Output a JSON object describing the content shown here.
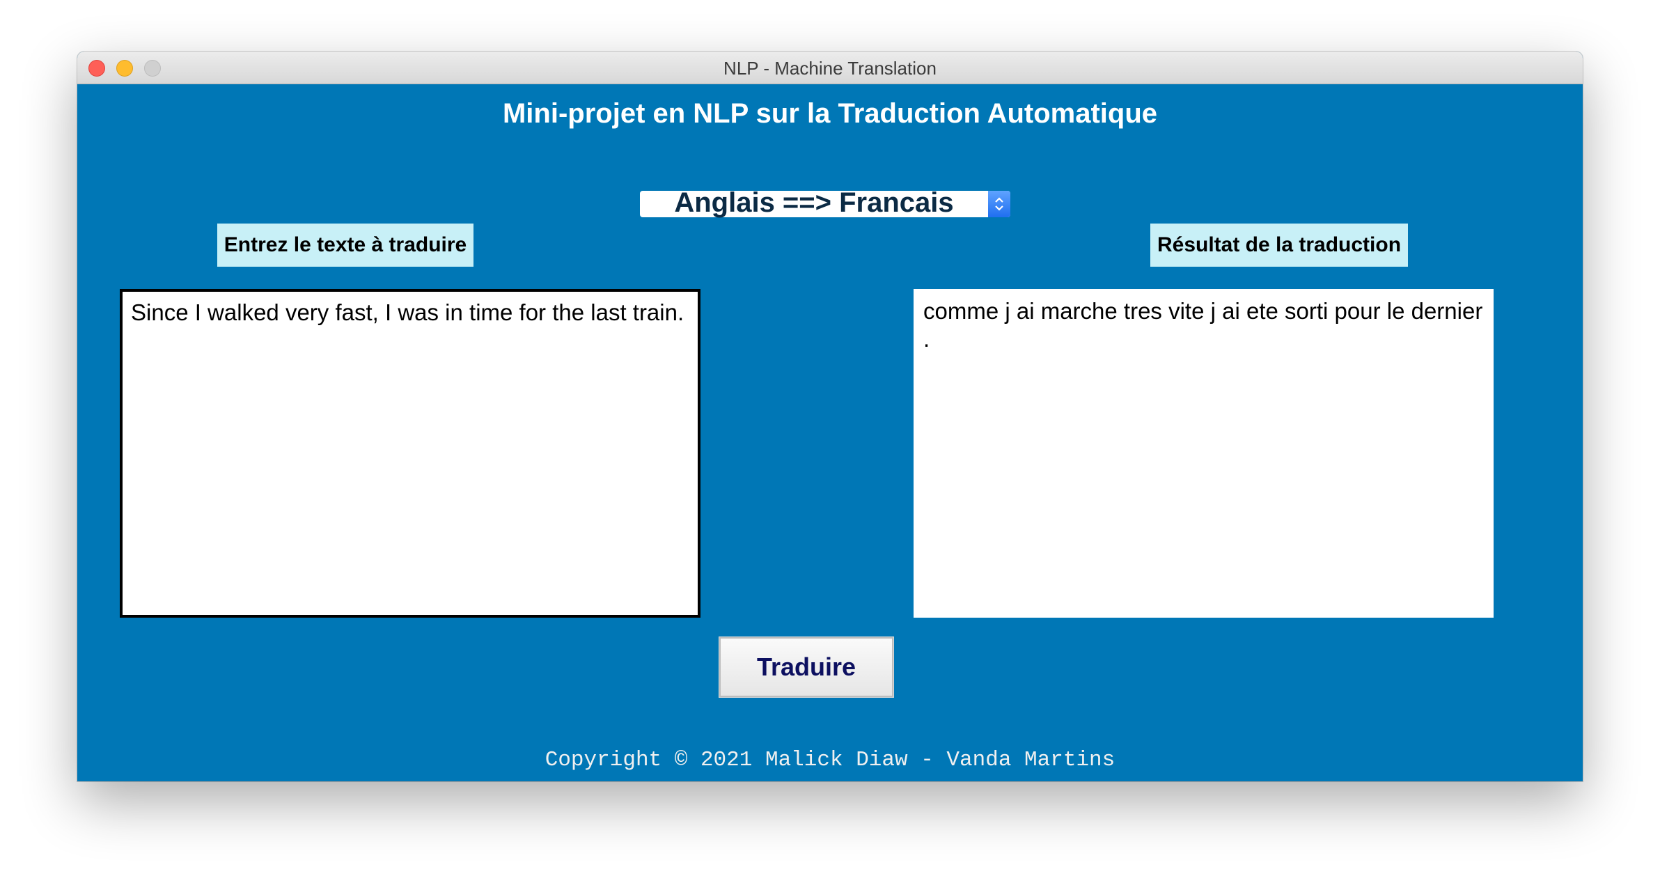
{
  "window": {
    "title": "NLP - Machine Translation"
  },
  "app": {
    "heading": "Mini-projet en NLP sur la Traduction Automatique",
    "direction_select": {
      "selected": "Anglais ==> Francais"
    },
    "input_label": "Entrez le texte à traduire",
    "output_label": "Résultat de la traduction",
    "input_text": "Since I walked very fast, I was in time for the last train.",
    "output_text": "comme j ai marche tres vite j ai ete sorti pour le dernier .",
    "translate_button": "Traduire",
    "footer": "Copyright © 2021 Malick Diaw - Vanda Martins"
  },
  "icons": {
    "select_arrows": "chevron-up-down-icon"
  },
  "colors": {
    "background": "#0077b6",
    "label_bg": "#c8f0f7",
    "button_text": "#0d1060"
  }
}
